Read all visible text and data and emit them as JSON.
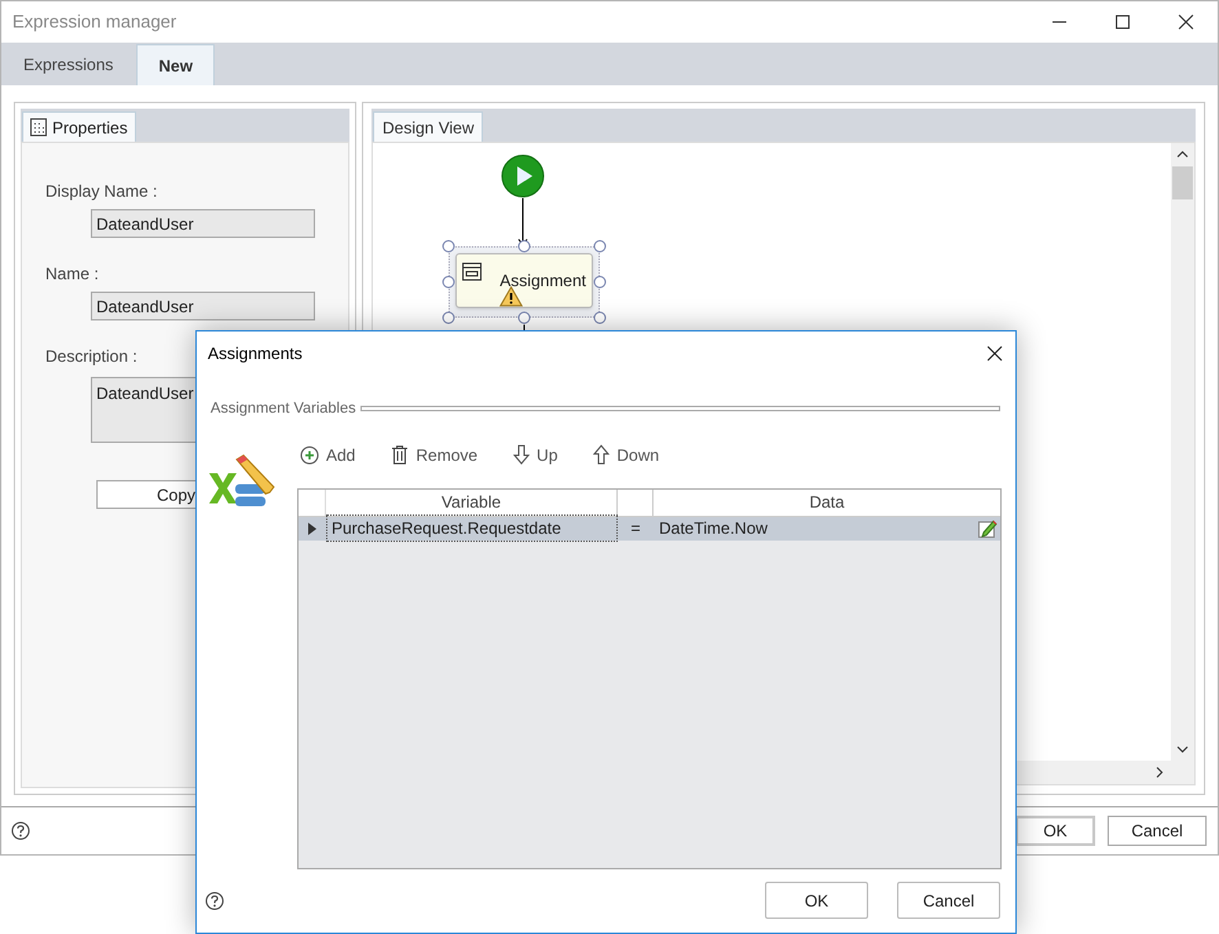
{
  "window": {
    "title": "Expression manager"
  },
  "tabs": [
    {
      "label": "Expressions",
      "selected": false
    },
    {
      "label": "New",
      "selected": true
    }
  ],
  "properties_panel": {
    "tab": "Properties",
    "fields": [
      {
        "label": "Display Name :",
        "value": "DateandUser",
        "kind": "text"
      },
      {
        "label": "Name :",
        "value": "DateandUser",
        "kind": "text"
      },
      {
        "label": "Description :",
        "value": "DateandUser",
        "kind": "multiline"
      }
    ],
    "button": "Copy"
  },
  "design_view": {
    "tab": "Design View",
    "node": {
      "label": "Assignment",
      "selected": true,
      "warning": true
    }
  },
  "footer": {
    "buttons": [
      "OK",
      "Cancel"
    ]
  },
  "dialog": {
    "title": "Assignments",
    "group": "Assignment Variables",
    "toolbar": [
      {
        "label": "Add",
        "kind": "add"
      },
      {
        "label": "Remove",
        "kind": "remove"
      },
      {
        "label": "Up",
        "kind": "up"
      },
      {
        "label": "Down",
        "kind": "down"
      }
    ],
    "columns": [
      "Variable",
      "Data"
    ],
    "rows": [
      {
        "variable": "PurchaseRequest.Requestdate",
        "operator": "=",
        "data": "DateTime.Now",
        "selected": true
      }
    ],
    "buttons": [
      "OK",
      "Cancel"
    ]
  }
}
